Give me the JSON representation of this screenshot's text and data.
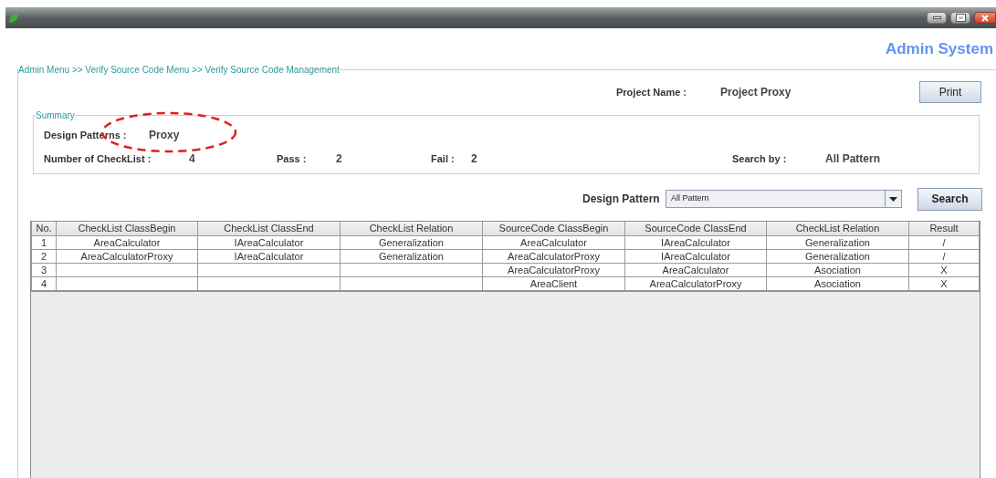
{
  "header": {
    "title": "Admin System"
  },
  "breadcrumb": "Admin Menu >> Verify Source Code Menu >> Verify Source Code Management",
  "project": {
    "label": "Project Name :",
    "value": "Project Proxy"
  },
  "print_button": "Print",
  "summary": {
    "legend": "Summary",
    "design_patterns": {
      "label": "Design Patterns :",
      "value": "Proxy"
    },
    "stats": [
      {
        "label": "Number of CheckList :",
        "value": "4"
      },
      {
        "label": "Pass :",
        "value": "2"
      },
      {
        "label": "Fail :",
        "value": "2"
      },
      {
        "label": "Search by :",
        "value": "All Pattern"
      }
    ]
  },
  "filter": {
    "label": "Design Pattern",
    "value": "All Pattern",
    "button": "Search"
  },
  "table": {
    "columns": [
      "No.",
      "CheckList ClassBegin",
      "CheckList ClassEnd",
      "CheckList Relation",
      "SourceCode ClassBegin",
      "SourceCode ClassEnd",
      "CheckList Relation",
      "Result"
    ],
    "rows": [
      [
        "1",
        "AreaCalculator",
        "IAreaCalculator",
        "Generalization",
        "AreaCalculator",
        "IAreaCalculator",
        "Generalization",
        "/"
      ],
      [
        "2",
        "AreaCalculatorProxy",
        "IAreaCalculator",
        "Generalization",
        "AreaCalculatorProxy",
        "IAreaCalculator",
        "Generalization",
        "/"
      ],
      [
        "3",
        "",
        "",
        "",
        "AreaCalculatorProxy",
        "AreaCalculator",
        "Asociation",
        "X"
      ],
      [
        "4",
        "",
        "",
        "",
        "AreaClient",
        "AreaCalculatorProxy",
        "Asociation",
        "X"
      ]
    ]
  }
}
